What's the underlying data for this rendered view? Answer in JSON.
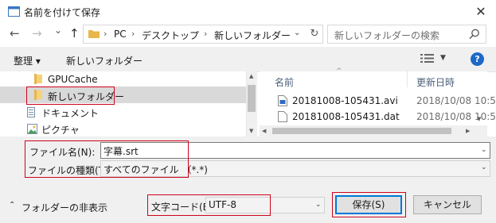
{
  "window": {
    "title": "名前を付けて保存",
    "close_glyph": "✕"
  },
  "nav": {
    "back_glyph": "←",
    "forward_glyph": "→",
    "recent_glyph": "⌄",
    "up_glyph": "↑",
    "breadcrumbs": [
      "PC",
      "デスクトップ",
      "新しいフォルダー"
    ],
    "separator": "›",
    "refresh_glyph": "↻",
    "search_placeholder": "新しいフォルダーの検索"
  },
  "toolbar": {
    "organize_label": "整理 ▾",
    "new_folder_label": "新しいフォルダー",
    "help_glyph": "?"
  },
  "tree": {
    "items": [
      {
        "label": "GPUCache",
        "icon": "folder-icon"
      },
      {
        "label": "新しいフォルダー",
        "icon": "folder-icon",
        "selected": true
      },
      {
        "label": "ドキュメント",
        "icon": "documents-icon"
      },
      {
        "label": "ピクチャ",
        "icon": "pictures-icon"
      }
    ]
  },
  "filelist": {
    "columns": {
      "name": "名前",
      "date": "更新日時"
    },
    "rows": [
      {
        "name": "20181008-105431.avi",
        "date": "2018/10/08 10:5",
        "icon": "video-file-icon"
      },
      {
        "name": "20181008-105431.dat",
        "date": "2018/10/08 10:5",
        "icon": "file-icon"
      }
    ]
  },
  "form": {
    "filename_label": "ファイル名(N):",
    "filename_value": "字幕.srt",
    "filetype_label": "ファイルの種類(T):",
    "filetype_value": "すべてのファイル （*.*)"
  },
  "bottom": {
    "hide_folders_label": "フォルダーの非表示",
    "encoding_label": "文字コード(E):",
    "encoding_value": "UTF-8",
    "save_label": "保存(S)",
    "cancel_label": "キャンセル"
  },
  "colors": {
    "accent": "#0078d7",
    "highlight": "#d0021b",
    "selection": "#cce8ff",
    "folder": "#e8b64a"
  }
}
